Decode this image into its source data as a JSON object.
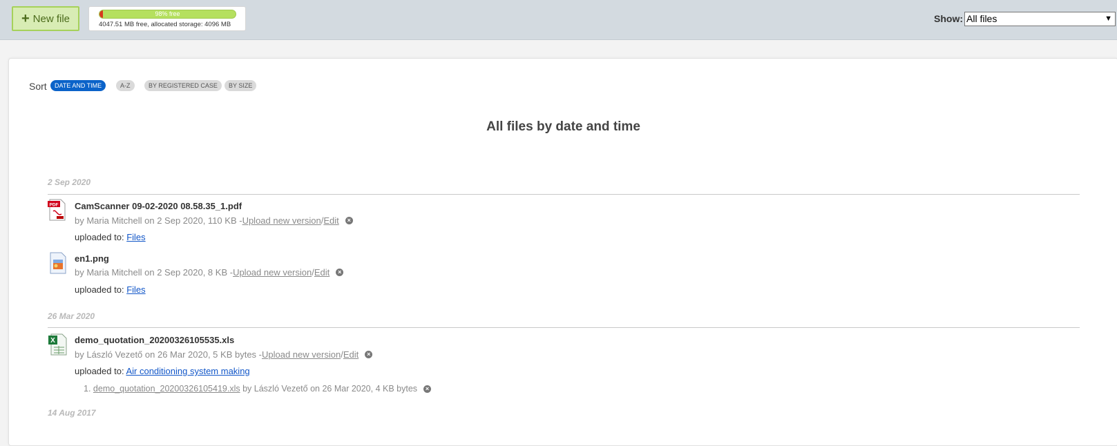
{
  "toolbar": {
    "new_file_label": "New file",
    "storage": {
      "free_label": "98% free",
      "free_fraction": 0.98,
      "detail": "4047.51 MB free, allocated storage: 4096 MB"
    },
    "show_label": "Show:",
    "show_value": "All files"
  },
  "sort": {
    "label": "Sort",
    "options": [
      "DATE AND TIME",
      "A-Z",
      "BY REGISTERED CASE",
      "BY SIZE"
    ],
    "active": "DATE AND TIME"
  },
  "list_title": "All files by date and time",
  "groups": [
    {
      "date": "2 Sep 2020",
      "files": [
        {
          "icon": "pdf-icon",
          "name": "CamScanner 09-02-2020 08.58.35_1.pdf",
          "meta": "by Maria Mitchell on 2 Sep 2020, 110 KB - ",
          "upload_new_version": "Upload new version",
          "sep": "/ ",
          "edit": "Edit",
          "uploaded_to_label": "uploaded to: ",
          "uploaded_to": "Files"
        },
        {
          "icon": "image-icon",
          "name": "en1.png",
          "meta": "by Maria Mitchell on 2 Sep 2020, 8 KB - ",
          "upload_new_version": "Upload new version",
          "sep": "/ ",
          "edit": "Edit",
          "uploaded_to_label": "uploaded to: ",
          "uploaded_to": "Files"
        }
      ]
    },
    {
      "date": "26 Mar 2020",
      "files": [
        {
          "icon": "excel-icon",
          "name": "demo_quotation_20200326105535.xls",
          "meta": "by László Vezető on 26 Mar 2020, 5 KB bytes - ",
          "upload_new_version": "Upload new version",
          "sep": "/ ",
          "edit": "Edit",
          "uploaded_to_label": "uploaded to: ",
          "uploaded_to": "Air conditioning system making",
          "versions": [
            {
              "num": "1.",
              "name": "demo_quotation_20200326105419.xls",
              "meta": "by László Vezető on 26 Mar 2020, 4 KB bytes"
            }
          ]
        }
      ]
    },
    {
      "date": "14 Aug 2017",
      "files": []
    }
  ],
  "colors": {
    "accent": "#0b63c9",
    "new_file_bg": "#d8ecb4",
    "storage_free": "#b5e05f",
    "storage_used": "#d73a1e"
  }
}
